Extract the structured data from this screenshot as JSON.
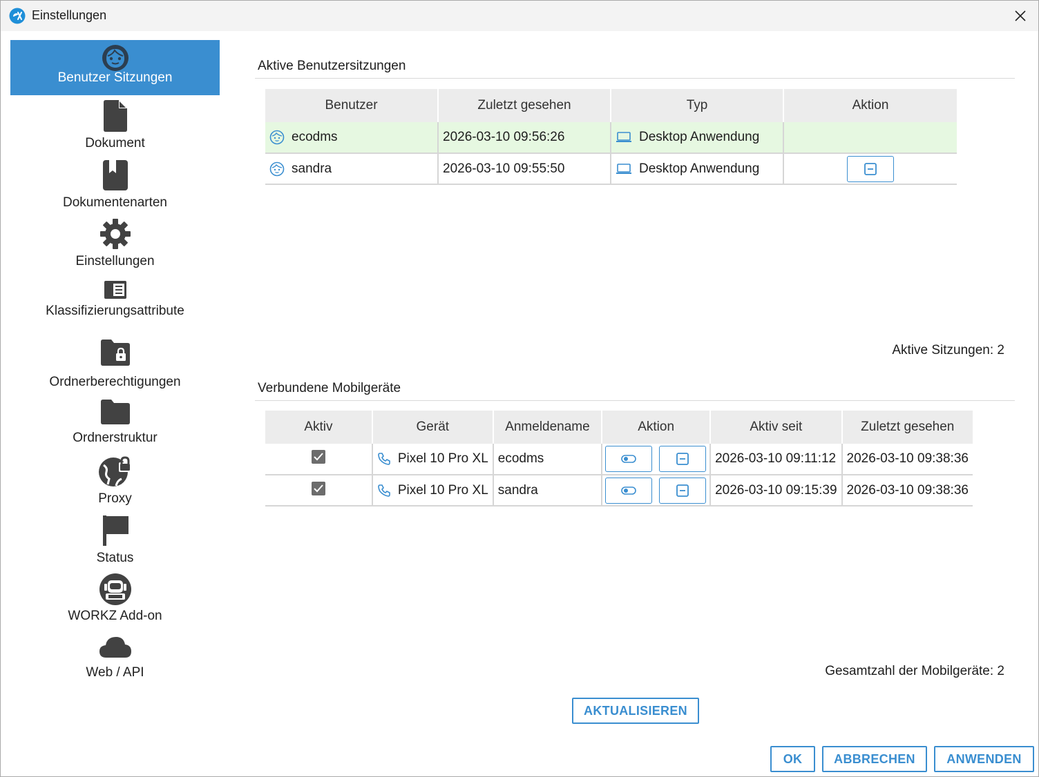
{
  "window": {
    "title": "Einstellungen"
  },
  "sidebar": {
    "items": [
      {
        "label": "Benutzer Sitzungen",
        "icon": "user-face-icon"
      },
      {
        "label": "Dokument",
        "icon": "document-icon"
      },
      {
        "label": "Dokumentenarten",
        "icon": "bookmark-book-icon"
      },
      {
        "label": "Einstellungen",
        "icon": "gear-icon"
      },
      {
        "label": "Klassifizierungsattribute",
        "icon": "list-panel-icon"
      },
      {
        "label": "Ordnerberechtigungen",
        "icon": "folder-lock-icon"
      },
      {
        "label": "Ordnerstruktur",
        "icon": "folder-icon"
      },
      {
        "label": "Proxy",
        "icon": "globe-lock-icon"
      },
      {
        "label": "Status",
        "icon": "flag-icon"
      },
      {
        "label": "WORKZ Add-on",
        "icon": "robot-icon"
      },
      {
        "label": "Web / API",
        "icon": "cloud-icon"
      }
    ]
  },
  "sessions": {
    "title": "Aktive Benutzersitzungen",
    "headers": [
      "Benutzer",
      "Zuletzt gesehen",
      "Typ",
      "Aktion"
    ],
    "rows": [
      {
        "user": "ecodms",
        "last_seen": "2026-03-10 09:56:26",
        "type": "Desktop Anwendung",
        "highlight": true
      },
      {
        "user": "sandra",
        "last_seen": "2026-03-10 09:55:50",
        "type": "Desktop Anwendung",
        "highlight": false
      }
    ],
    "count_text": "Aktive Sitzungen: 2"
  },
  "mobile": {
    "title": "Verbundene Mobilgeräte",
    "headers": [
      "Aktiv",
      "Gerät",
      "Anmeldename",
      "Aktion",
      "Aktiv seit",
      "Zuletzt gesehen"
    ],
    "rows": [
      {
        "active": true,
        "device": "Pixel 10 Pro XL",
        "login": "ecodms",
        "active_since": "2026-03-10 09:11:12",
        "last_seen": "2026-03-10 09:38:36"
      },
      {
        "active": true,
        "device": "Pixel 10 Pro XL",
        "login": "sandra",
        "active_since": "2026-03-10 09:15:39",
        "last_seen": "2026-03-10 09:38:36"
      }
    ],
    "count_text": "Gesamtzahl der Mobilgeräte: 2"
  },
  "buttons": {
    "refresh": "AKTUALISIEREN",
    "ok": "OK",
    "cancel": "ABBRECHEN",
    "apply": "ANWENDEN"
  },
  "colors": {
    "accent": "#3a8ed0",
    "highlight_row": "#e6f8e1",
    "header_bg": "#ececec"
  }
}
